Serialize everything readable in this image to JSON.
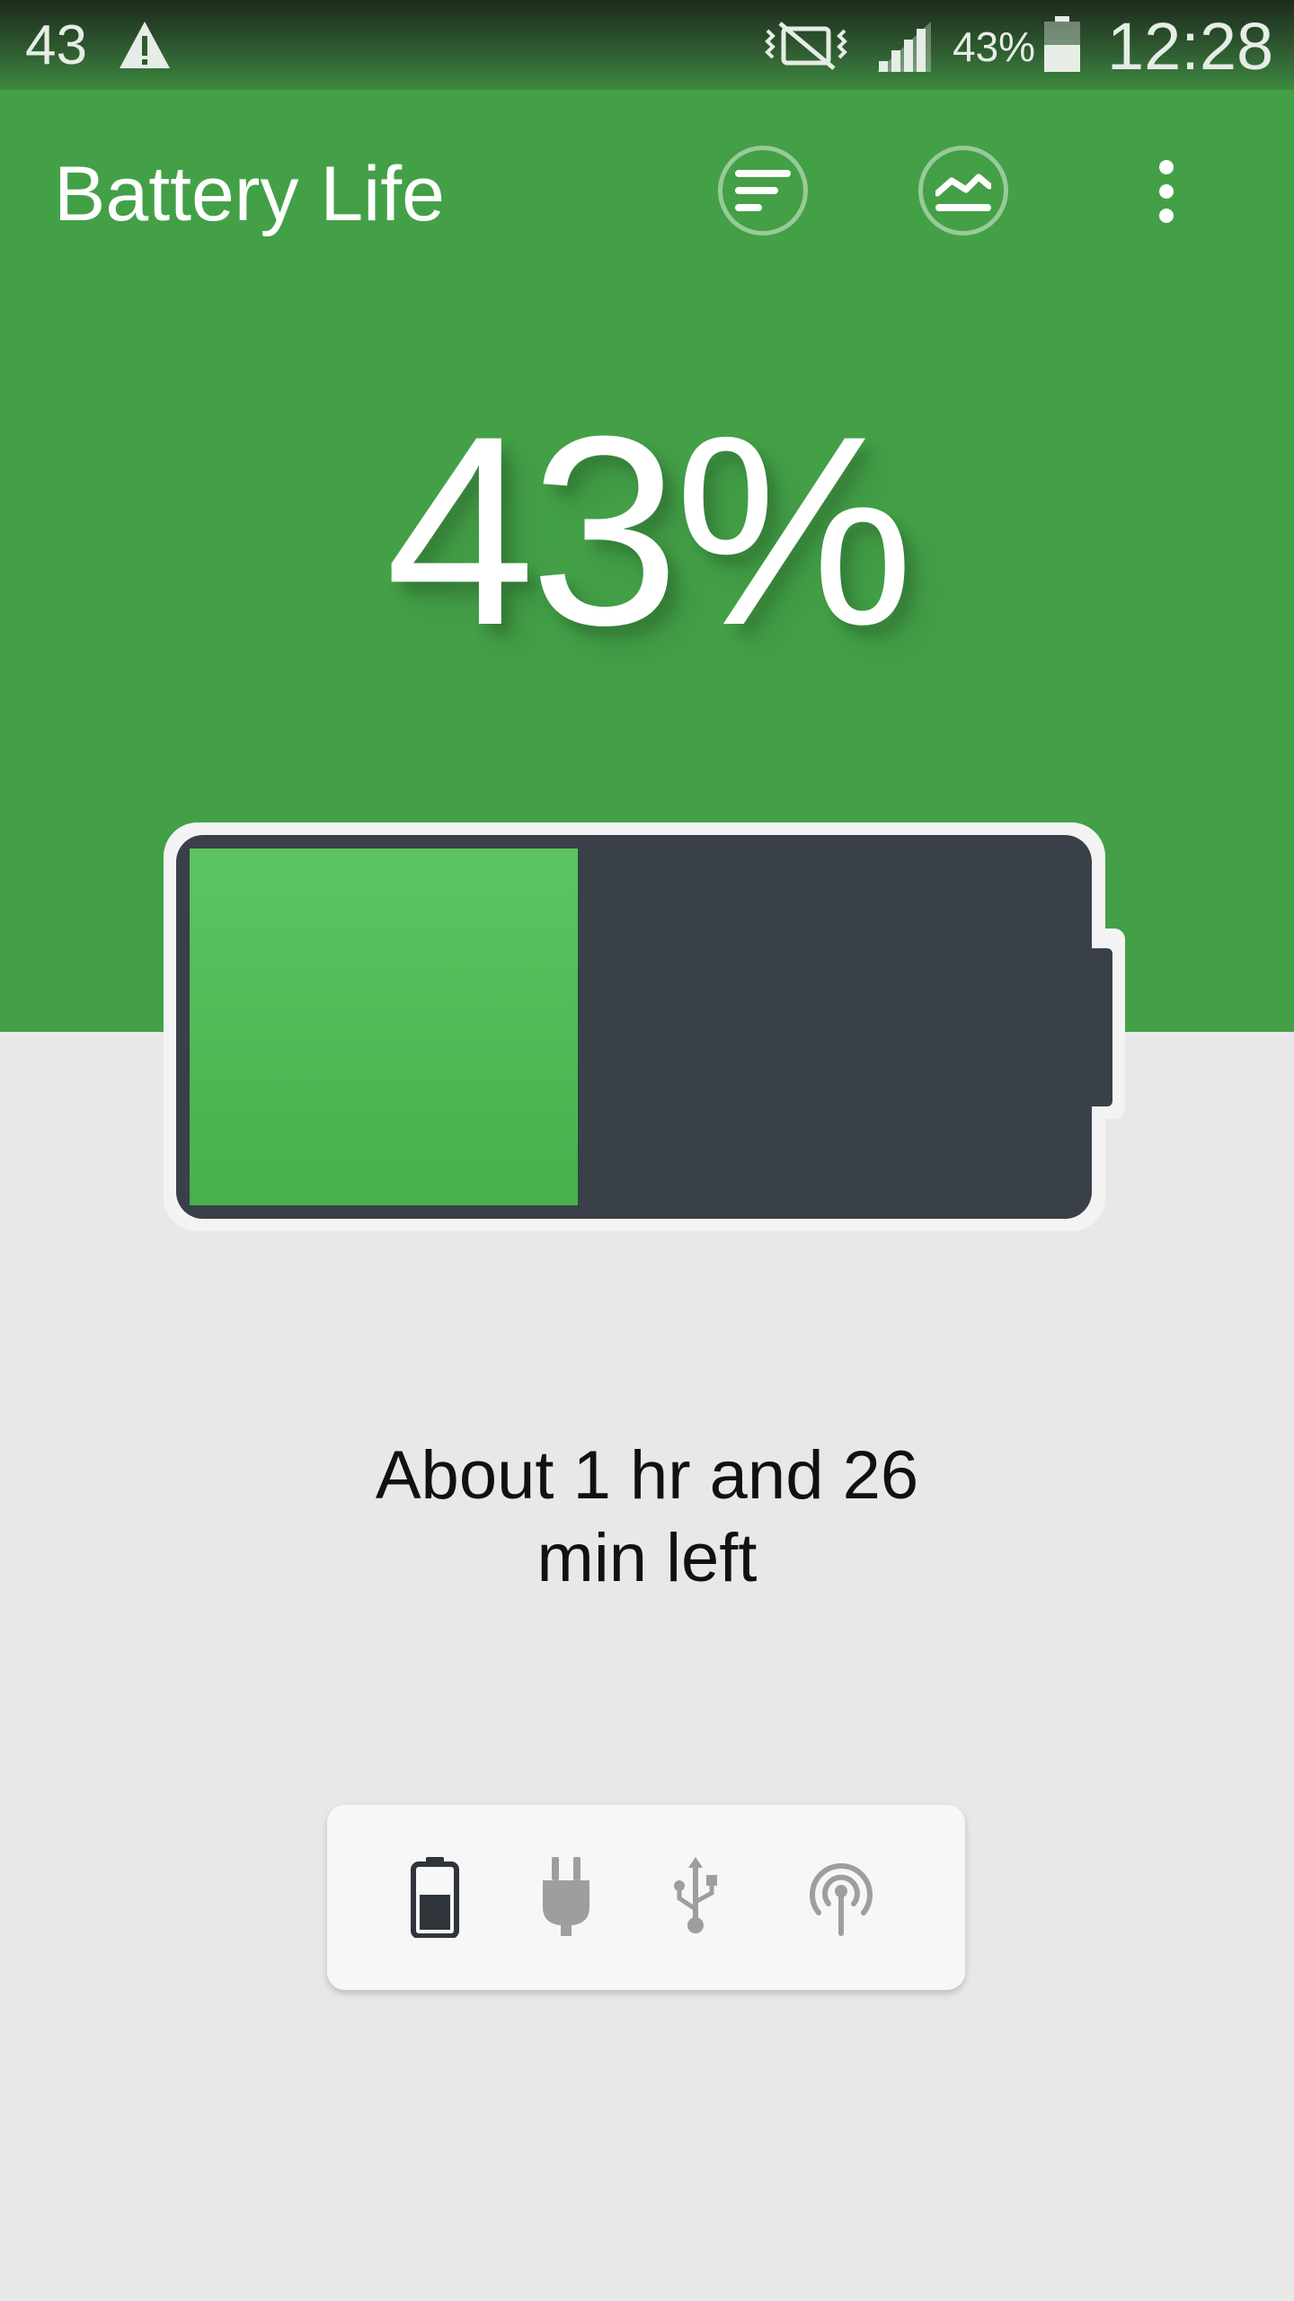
{
  "status_bar": {
    "notification_count": "43",
    "battery_percent": "43%",
    "time": "12:28",
    "icons": [
      "warning-icon",
      "vibrate-mute-icon",
      "signal-icon",
      "battery-icon"
    ]
  },
  "app_bar": {
    "title": "Battery Life",
    "actions": [
      "sort-icon",
      "chart-icon",
      "more-vert-icon"
    ]
  },
  "battery": {
    "percent_label": "43%",
    "level": 0.43,
    "fill_color": "#4caf50",
    "body_color": "#394048",
    "time_left_line1": "About 1 hr and 26",
    "time_left_line2": "min left"
  },
  "power_sources": {
    "items": [
      {
        "name": "battery",
        "icon": "battery-icon",
        "active": true
      },
      {
        "name": "ac",
        "icon": "plug-icon",
        "active": false
      },
      {
        "name": "usb",
        "icon": "usb-icon",
        "active": false
      },
      {
        "name": "wireless",
        "icon": "wireless-icon",
        "active": false
      }
    ]
  },
  "colors": {
    "primary": "#43a047",
    "background": "#e8e8e8",
    "card": "#f7f7f7",
    "inactive_icon": "#9e9e9e"
  }
}
